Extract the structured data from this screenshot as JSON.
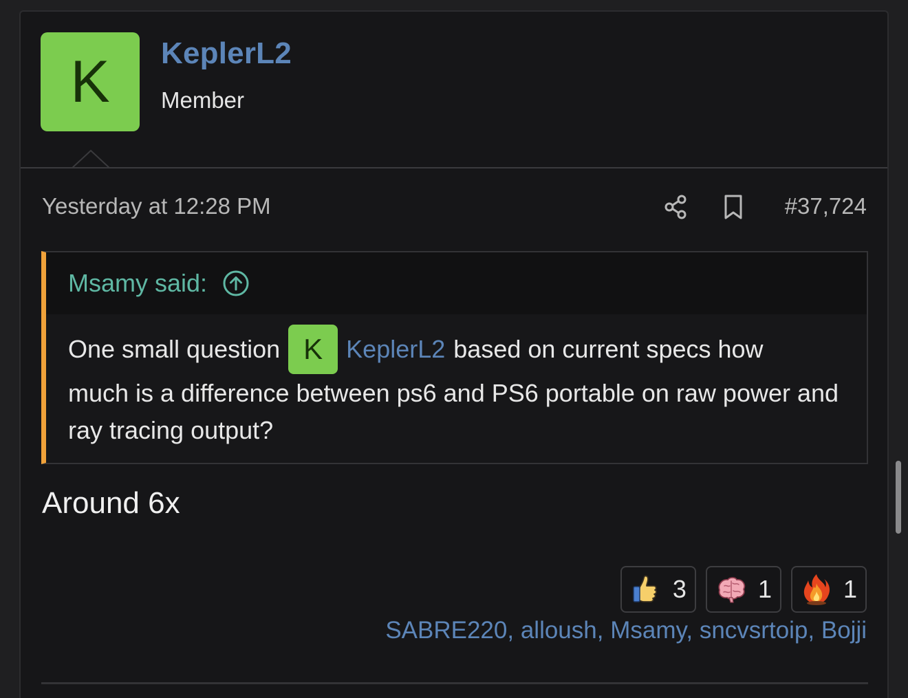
{
  "user": {
    "avatar_letter": "K",
    "name": "KeplerL2",
    "title": "Member"
  },
  "meta": {
    "timestamp": "Yesterday at 12:28 PM",
    "post_number": "#37,724"
  },
  "quote": {
    "attribution": "Msamy said:",
    "text_before_mention": "One small question",
    "mention_avatar_letter": "K",
    "mention_name": "KeplerL2",
    "text_after_mention": "based on current specs how",
    "text_rest": "much is a difference between ps6 and PS6 portable on raw power and ray tracing output?"
  },
  "reply": {
    "text": "Around 6x"
  },
  "reactions": [
    {
      "icon": "thumbs-up-icon",
      "count": "3"
    },
    {
      "icon": "brain-icon",
      "count": "1"
    },
    {
      "icon": "fire-icon",
      "count": "1"
    }
  ],
  "reactors": {
    "names": [
      "SABRE220",
      "alloush",
      "Msamy",
      "sncvsrtoip",
      "Bojji"
    ]
  },
  "colors": {
    "accent_link": "#5c85b8",
    "avatar_green": "#7ccc4f",
    "quote_bar": "#f0a23a",
    "quote_attribution": "#5fb8a4"
  }
}
